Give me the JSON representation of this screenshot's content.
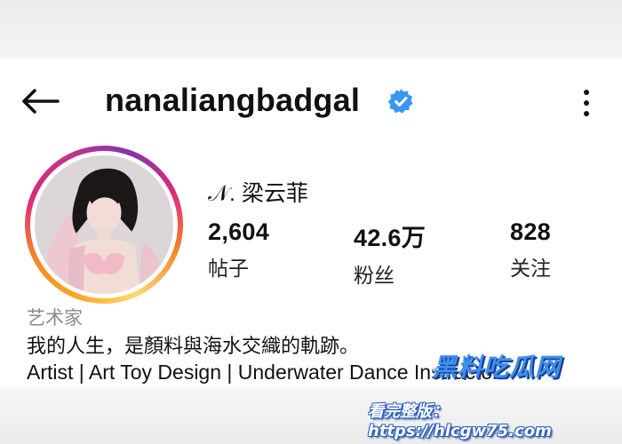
{
  "header": {
    "username": "nanaliangbadgal",
    "back_icon": "arrow-left-icon",
    "verified_icon": "verified-badge-icon",
    "more_icon": "more-vertical-icon"
  },
  "profile": {
    "display_name": "𝒩. 梁云菲",
    "stats": [
      {
        "value": "2,604",
        "label": "帖子"
      },
      {
        "value": "42.6万",
        "label": "粉丝"
      },
      {
        "value": "828",
        "label": "关注"
      }
    ]
  },
  "bio": {
    "category": "艺术家",
    "line1": "我的人生，是顏料與海水交織的軌跡。",
    "line2": "Artist | Art Toy Design  | Underwater Dance Instructor"
  },
  "watermark": {
    "logo": "黑料吃瓜网",
    "url": "看完整版：https://hlcgw75.com"
  },
  "colors": {
    "verified": "#3897f0",
    "ring_start": "#f58529",
    "ring_mid": "#dd2a7b",
    "ring_end": "#8134af"
  }
}
